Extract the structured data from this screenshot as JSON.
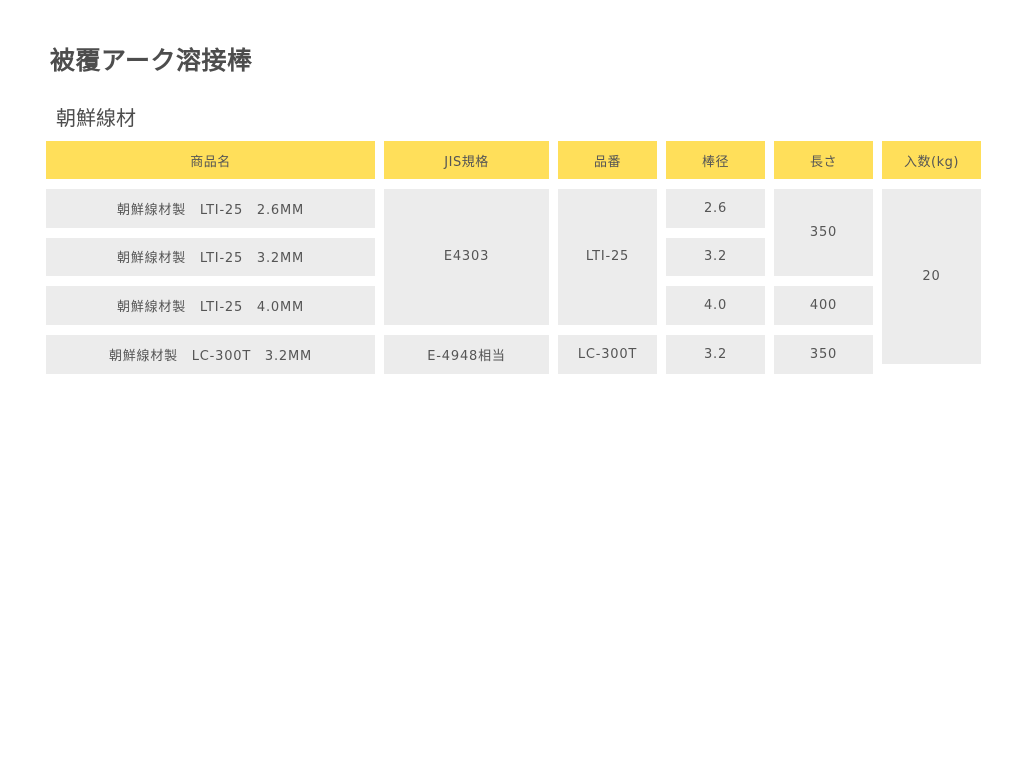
{
  "page": {
    "title": "被覆アーク溶接棒",
    "section": "朝鮮線材"
  },
  "table": {
    "headers": [
      "商品名",
      "JIS規格",
      "品番",
      "棒径",
      "長さ",
      "入数(kg)"
    ],
    "rows": [
      {
        "name": "朝鮮線材製　LTI-25　2.6MM",
        "diameter": "2.6"
      },
      {
        "name": "朝鮮線材製　LTI-25　3.2MM",
        "diameter": "3.2"
      },
      {
        "name": "朝鮮線材製　LTI-25　4.0MM",
        "diameter": "4.0"
      },
      {
        "name": "朝鮮線材製　LC-300T　3.2MM",
        "diameter": "3.2"
      }
    ],
    "merged": {
      "jis_lti": "E4303",
      "part_lti": "LTI-25",
      "length_350_a": "350",
      "length_400": "400",
      "jis_lc": "E-4948相当",
      "part_lc": "LC-300T",
      "length_350_b": "350",
      "quantity": "20"
    }
  },
  "colors": {
    "header_bg": "#ffdf5a",
    "cell_bg": "#ececec",
    "text": "#555555"
  }
}
